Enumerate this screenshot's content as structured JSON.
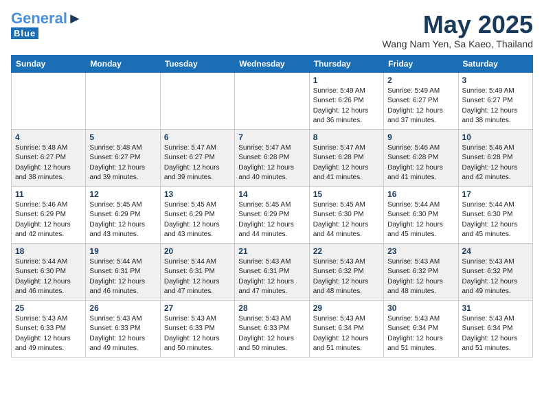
{
  "header": {
    "logo_general": "General",
    "logo_blue": "Blue",
    "month_title": "May 2025",
    "location": "Wang Nam Yen, Sa Kaeo, Thailand"
  },
  "days_of_week": [
    "Sunday",
    "Monday",
    "Tuesday",
    "Wednesday",
    "Thursday",
    "Friday",
    "Saturday"
  ],
  "weeks": [
    [
      {
        "num": "",
        "sunrise": "",
        "sunset": "",
        "daylight": ""
      },
      {
        "num": "",
        "sunrise": "",
        "sunset": "",
        "daylight": ""
      },
      {
        "num": "",
        "sunrise": "",
        "sunset": "",
        "daylight": ""
      },
      {
        "num": "",
        "sunrise": "",
        "sunset": "",
        "daylight": ""
      },
      {
        "num": "1",
        "sunrise": "Sunrise: 5:49 AM",
        "sunset": "Sunset: 6:26 PM",
        "daylight": "Daylight: 12 hours and 36 minutes."
      },
      {
        "num": "2",
        "sunrise": "Sunrise: 5:49 AM",
        "sunset": "Sunset: 6:27 PM",
        "daylight": "Daylight: 12 hours and 37 minutes."
      },
      {
        "num": "3",
        "sunrise": "Sunrise: 5:49 AM",
        "sunset": "Sunset: 6:27 PM",
        "daylight": "Daylight: 12 hours and 38 minutes."
      }
    ],
    [
      {
        "num": "4",
        "sunrise": "Sunrise: 5:48 AM",
        "sunset": "Sunset: 6:27 PM",
        "daylight": "Daylight: 12 hours and 38 minutes."
      },
      {
        "num": "5",
        "sunrise": "Sunrise: 5:48 AM",
        "sunset": "Sunset: 6:27 PM",
        "daylight": "Daylight: 12 hours and 39 minutes."
      },
      {
        "num": "6",
        "sunrise": "Sunrise: 5:47 AM",
        "sunset": "Sunset: 6:27 PM",
        "daylight": "Daylight: 12 hours and 39 minutes."
      },
      {
        "num": "7",
        "sunrise": "Sunrise: 5:47 AM",
        "sunset": "Sunset: 6:28 PM",
        "daylight": "Daylight: 12 hours and 40 minutes."
      },
      {
        "num": "8",
        "sunrise": "Sunrise: 5:47 AM",
        "sunset": "Sunset: 6:28 PM",
        "daylight": "Daylight: 12 hours and 41 minutes."
      },
      {
        "num": "9",
        "sunrise": "Sunrise: 5:46 AM",
        "sunset": "Sunset: 6:28 PM",
        "daylight": "Daylight: 12 hours and 41 minutes."
      },
      {
        "num": "10",
        "sunrise": "Sunrise: 5:46 AM",
        "sunset": "Sunset: 6:28 PM",
        "daylight": "Daylight: 12 hours and 42 minutes."
      }
    ],
    [
      {
        "num": "11",
        "sunrise": "Sunrise: 5:46 AM",
        "sunset": "Sunset: 6:29 PM",
        "daylight": "Daylight: 12 hours and 42 minutes."
      },
      {
        "num": "12",
        "sunrise": "Sunrise: 5:45 AM",
        "sunset": "Sunset: 6:29 PM",
        "daylight": "Daylight: 12 hours and 43 minutes."
      },
      {
        "num": "13",
        "sunrise": "Sunrise: 5:45 AM",
        "sunset": "Sunset: 6:29 PM",
        "daylight": "Daylight: 12 hours and 43 minutes."
      },
      {
        "num": "14",
        "sunrise": "Sunrise: 5:45 AM",
        "sunset": "Sunset: 6:29 PM",
        "daylight": "Daylight: 12 hours and 44 minutes."
      },
      {
        "num": "15",
        "sunrise": "Sunrise: 5:45 AM",
        "sunset": "Sunset: 6:30 PM",
        "daylight": "Daylight: 12 hours and 44 minutes."
      },
      {
        "num": "16",
        "sunrise": "Sunrise: 5:44 AM",
        "sunset": "Sunset: 6:30 PM",
        "daylight": "Daylight: 12 hours and 45 minutes."
      },
      {
        "num": "17",
        "sunrise": "Sunrise: 5:44 AM",
        "sunset": "Sunset: 6:30 PM",
        "daylight": "Daylight: 12 hours and 45 minutes."
      }
    ],
    [
      {
        "num": "18",
        "sunrise": "Sunrise: 5:44 AM",
        "sunset": "Sunset: 6:30 PM",
        "daylight": "Daylight: 12 hours and 46 minutes."
      },
      {
        "num": "19",
        "sunrise": "Sunrise: 5:44 AM",
        "sunset": "Sunset: 6:31 PM",
        "daylight": "Daylight: 12 hours and 46 minutes."
      },
      {
        "num": "20",
        "sunrise": "Sunrise: 5:44 AM",
        "sunset": "Sunset: 6:31 PM",
        "daylight": "Daylight: 12 hours and 47 minutes."
      },
      {
        "num": "21",
        "sunrise": "Sunrise: 5:43 AM",
        "sunset": "Sunset: 6:31 PM",
        "daylight": "Daylight: 12 hours and 47 minutes."
      },
      {
        "num": "22",
        "sunrise": "Sunrise: 5:43 AM",
        "sunset": "Sunset: 6:32 PM",
        "daylight": "Daylight: 12 hours and 48 minutes."
      },
      {
        "num": "23",
        "sunrise": "Sunrise: 5:43 AM",
        "sunset": "Sunset: 6:32 PM",
        "daylight": "Daylight: 12 hours and 48 minutes."
      },
      {
        "num": "24",
        "sunrise": "Sunrise: 5:43 AM",
        "sunset": "Sunset: 6:32 PM",
        "daylight": "Daylight: 12 hours and 49 minutes."
      }
    ],
    [
      {
        "num": "25",
        "sunrise": "Sunrise: 5:43 AM",
        "sunset": "Sunset: 6:33 PM",
        "daylight": "Daylight: 12 hours and 49 minutes."
      },
      {
        "num": "26",
        "sunrise": "Sunrise: 5:43 AM",
        "sunset": "Sunset: 6:33 PM",
        "daylight": "Daylight: 12 hours and 49 minutes."
      },
      {
        "num": "27",
        "sunrise": "Sunrise: 5:43 AM",
        "sunset": "Sunset: 6:33 PM",
        "daylight": "Daylight: 12 hours and 50 minutes."
      },
      {
        "num": "28",
        "sunrise": "Sunrise: 5:43 AM",
        "sunset": "Sunset: 6:33 PM",
        "daylight": "Daylight: 12 hours and 50 minutes."
      },
      {
        "num": "29",
        "sunrise": "Sunrise: 5:43 AM",
        "sunset": "Sunset: 6:34 PM",
        "daylight": "Daylight: 12 hours and 51 minutes."
      },
      {
        "num": "30",
        "sunrise": "Sunrise: 5:43 AM",
        "sunset": "Sunset: 6:34 PM",
        "daylight": "Daylight: 12 hours and 51 minutes."
      },
      {
        "num": "31",
        "sunrise": "Sunrise: 5:43 AM",
        "sunset": "Sunset: 6:34 PM",
        "daylight": "Daylight: 12 hours and 51 minutes."
      }
    ]
  ]
}
